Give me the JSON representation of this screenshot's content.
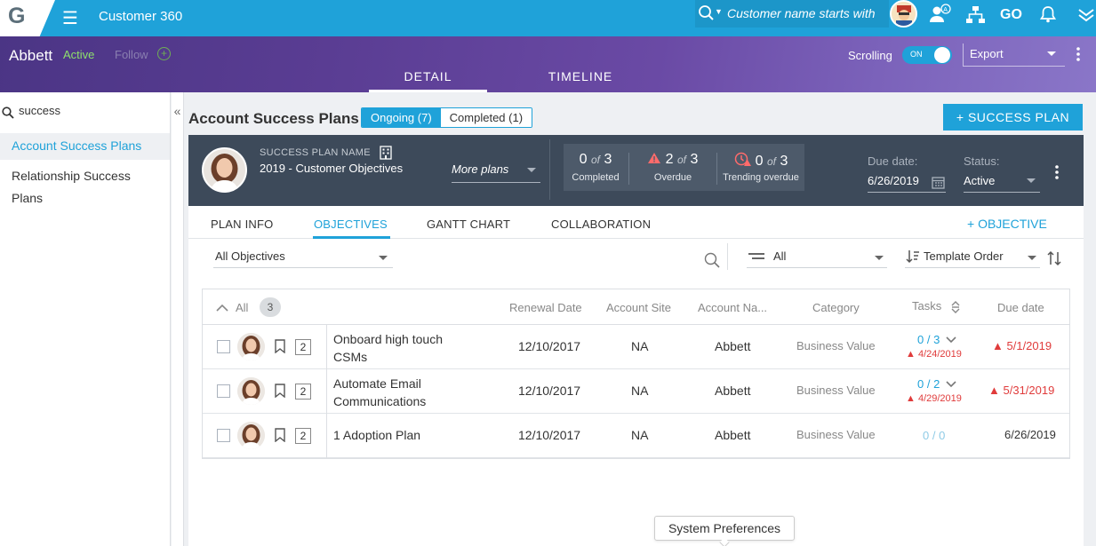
{
  "topbar": {
    "logo": "G",
    "app_title": "Customer 360",
    "search_placeholder": "Customer name starts with",
    "icons": [
      "menu-icon",
      "search-icon",
      "user-avatar",
      "user-add-icon",
      "hierarchy-icon",
      "go-icon",
      "bell-icon",
      "chevrons-down-icon"
    ],
    "go_label": "GO"
  },
  "header": {
    "account_name": "Abbett",
    "status": "Active",
    "follow_label": "Follow",
    "scrolling_label": "Scrolling",
    "toggle_label": "ON",
    "export_label": "Export",
    "tabs": [
      {
        "label": "DETAIL",
        "selected": true
      },
      {
        "label": "TIMELINE",
        "selected": false
      }
    ]
  },
  "sidebar": {
    "search_value": "success",
    "items": [
      {
        "label": "Account Success Plans",
        "selected": true
      },
      {
        "label": "Relationship Success",
        "label2": "Plans",
        "selected": false
      }
    ],
    "collapse_icon": "double-chevron-left-icon"
  },
  "main": {
    "title": "Account Success Plans",
    "ongoing_label": "Ongoing (7)",
    "completed_label": "Completed (1)",
    "add_plan_label": "+ SUCCESS PLAN"
  },
  "plan": {
    "name_label": "SUCCESS PLAN NAME",
    "name": "2019 - Customer Objectives",
    "more_plans": "More plans",
    "stats": [
      {
        "value": "0",
        "of": "of",
        "total": "3",
        "label": "Completed"
      },
      {
        "value": "2",
        "of": "of",
        "total": "3",
        "label": "Overdue"
      },
      {
        "value": "0",
        "of": "of",
        "total": "3",
        "label": "Trending overdue"
      }
    ],
    "due_label": "Due date:",
    "due_value": "6/26/2019",
    "status_label": "Status:",
    "status_value": "Active"
  },
  "subtabs": [
    {
      "label": "PLAN INFO",
      "selected": false
    },
    {
      "label": "OBJECTIVES",
      "selected": true
    },
    {
      "label": "GANTT CHART",
      "selected": false
    },
    {
      "label": "COLLABORATION",
      "selected": false
    }
  ],
  "add_objective_label": "+ OBJECTIVE",
  "filters": {
    "objectives_filter": "All Objectives",
    "type_filter": "All",
    "order_filter": "Template Order"
  },
  "grid": {
    "all_label": "All",
    "count": "3",
    "columns": [
      "Renewal Date",
      "Account Site",
      "Account Na...",
      "Category",
      "Tasks",
      "Due date"
    ],
    "rows": [
      {
        "badge": "2",
        "name": "Onboard high touch",
        "name2": "CSMs",
        "renewal": "12/10/2017",
        "site": "NA",
        "account": "Abbett",
        "category": "Business Value",
        "tasks": "0 / 3",
        "task_due": "4/24/2019",
        "due": "5/1/2019",
        "overdue": true
      },
      {
        "badge": "2",
        "name": "Automate Email",
        "name2": "Communications",
        "renewal": "12/10/2017",
        "site": "NA",
        "account": "Abbett",
        "category": "Business Value",
        "tasks": "0 / 2",
        "task_due": "4/29/2019",
        "due": "5/31/2019",
        "overdue": true
      },
      {
        "badge": "2",
        "name": "1 Adoption Plan",
        "name2": "",
        "renewal": "12/10/2017",
        "site": "NA",
        "account": "Abbett",
        "category": "Business Value",
        "tasks": "0 / 0",
        "task_due": "",
        "due": "6/26/2019",
        "overdue": false
      }
    ]
  },
  "tooltip": "System Preferences",
  "colors": {
    "accent": "#1fa2d9",
    "header_dark": "#3d4a5a",
    "danger": "#e03b3b",
    "active_green": "#8ee06c"
  }
}
